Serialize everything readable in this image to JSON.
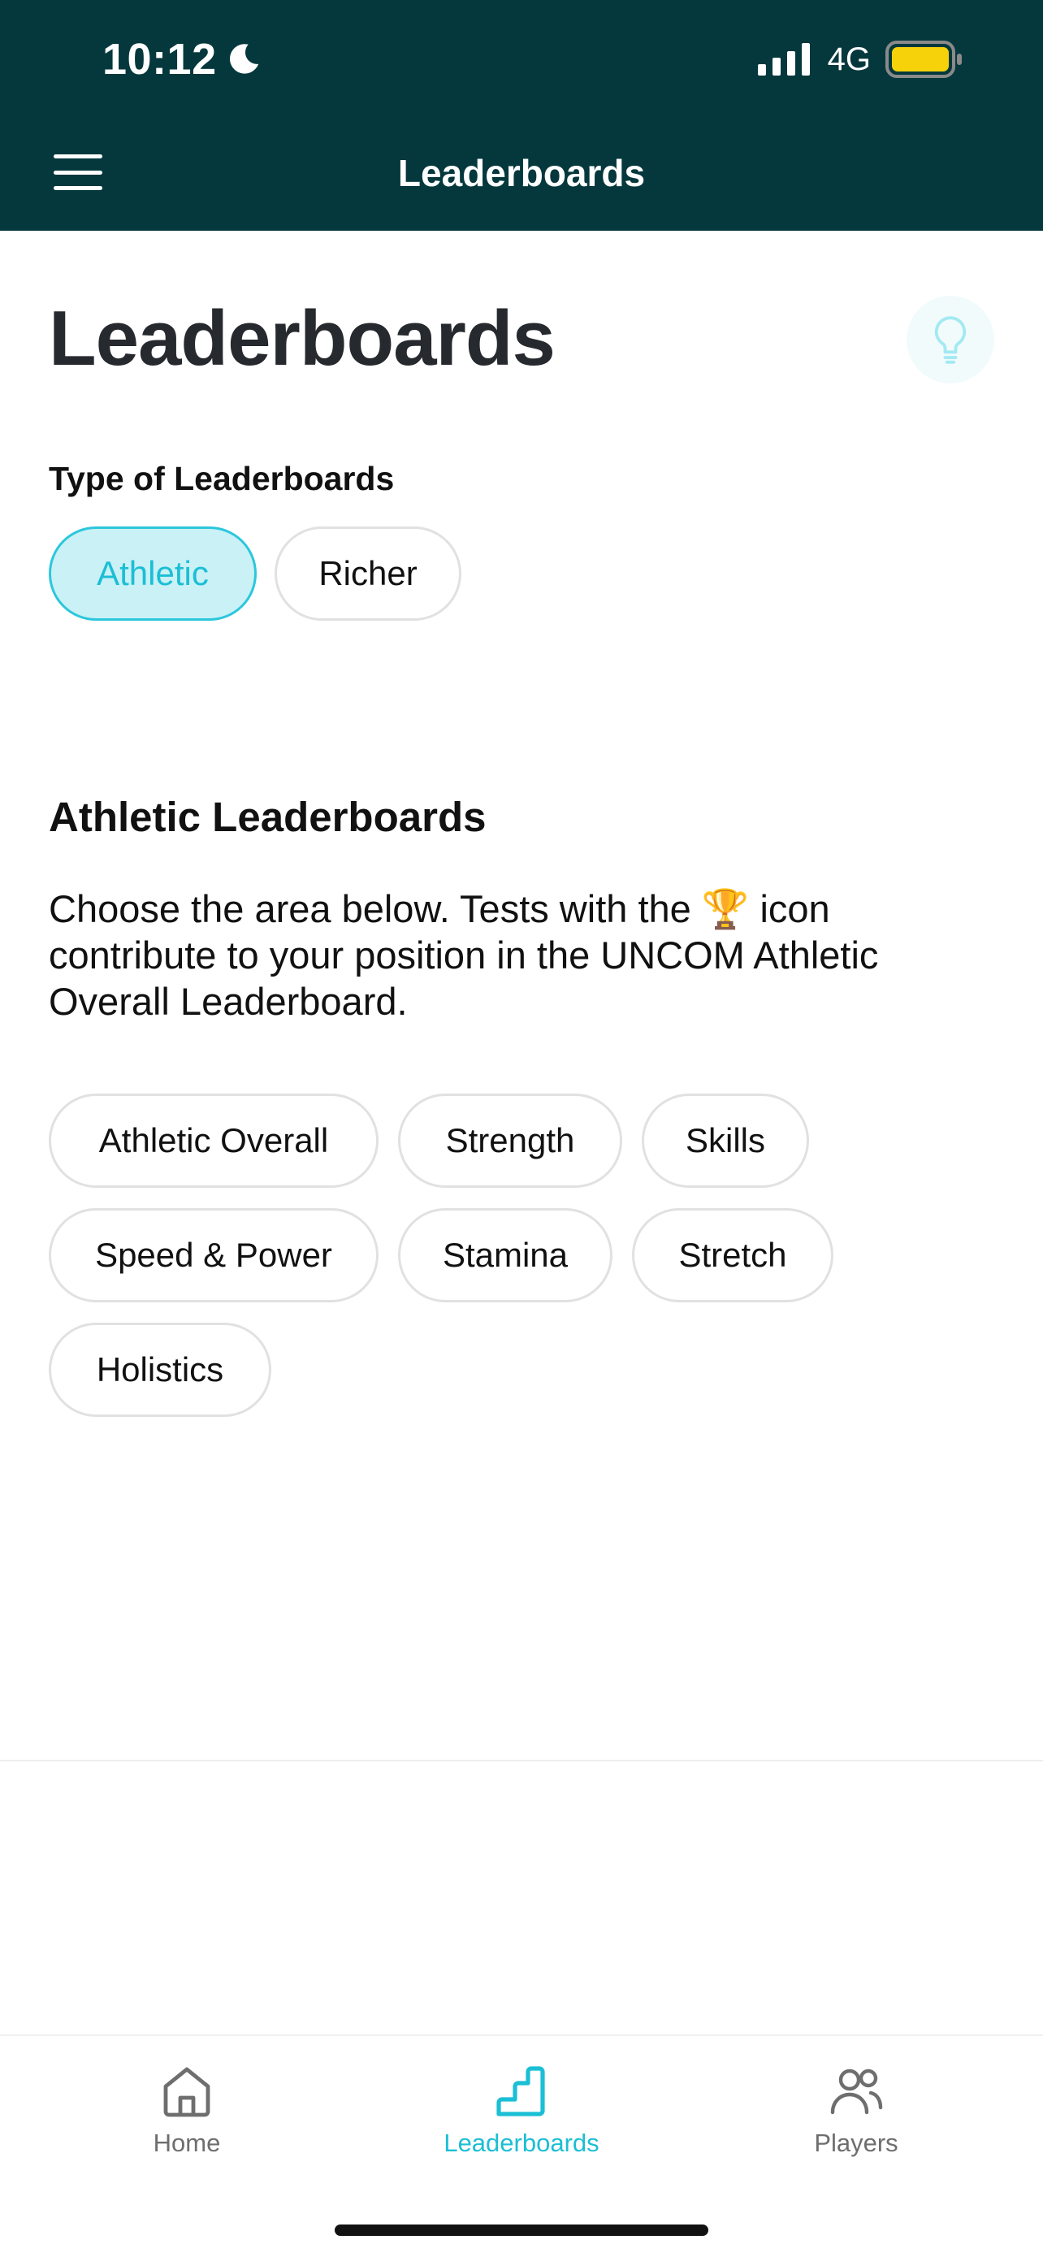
{
  "status_bar": {
    "time": "10:12",
    "network": "4G",
    "icons": [
      "moon-icon",
      "signal-icon",
      "battery-icon"
    ],
    "battery_color": "#f5d20a"
  },
  "header": {
    "title": "Leaderboards",
    "menu_icon": "hamburger-menu-icon"
  },
  "page": {
    "title": "Leaderboards",
    "tip_icon": "lightbulb-icon",
    "type_label": "Type of Leaderboards",
    "types": [
      {
        "label": "Athletic",
        "selected": true
      },
      {
        "label": "Richer",
        "selected": false
      }
    ],
    "section_heading": "Athletic Leaderboards",
    "description_before_icon": "Choose the area below. Tests with the",
    "description_icon": "🏆",
    "description_after_icon": "icon contribute to your position in the UNCOM Athletic Overall Leaderboard.",
    "areas": [
      "Athletic Overall",
      "Strength",
      "Skills",
      "Speed & Power",
      "Stamina",
      "Stretch",
      "Holistics"
    ]
  },
  "tabs": [
    {
      "label": "Home",
      "icon": "home-icon",
      "active": false
    },
    {
      "label": "Leaderboards",
      "icon": "leaderboards-icon",
      "active": true
    },
    {
      "label": "Players",
      "icon": "players-icon",
      "active": false
    }
  ],
  "colors": {
    "header_bg": "#05383d",
    "accent": "#1bbfd5",
    "selected_chip_bg": "#c9f1f6"
  }
}
